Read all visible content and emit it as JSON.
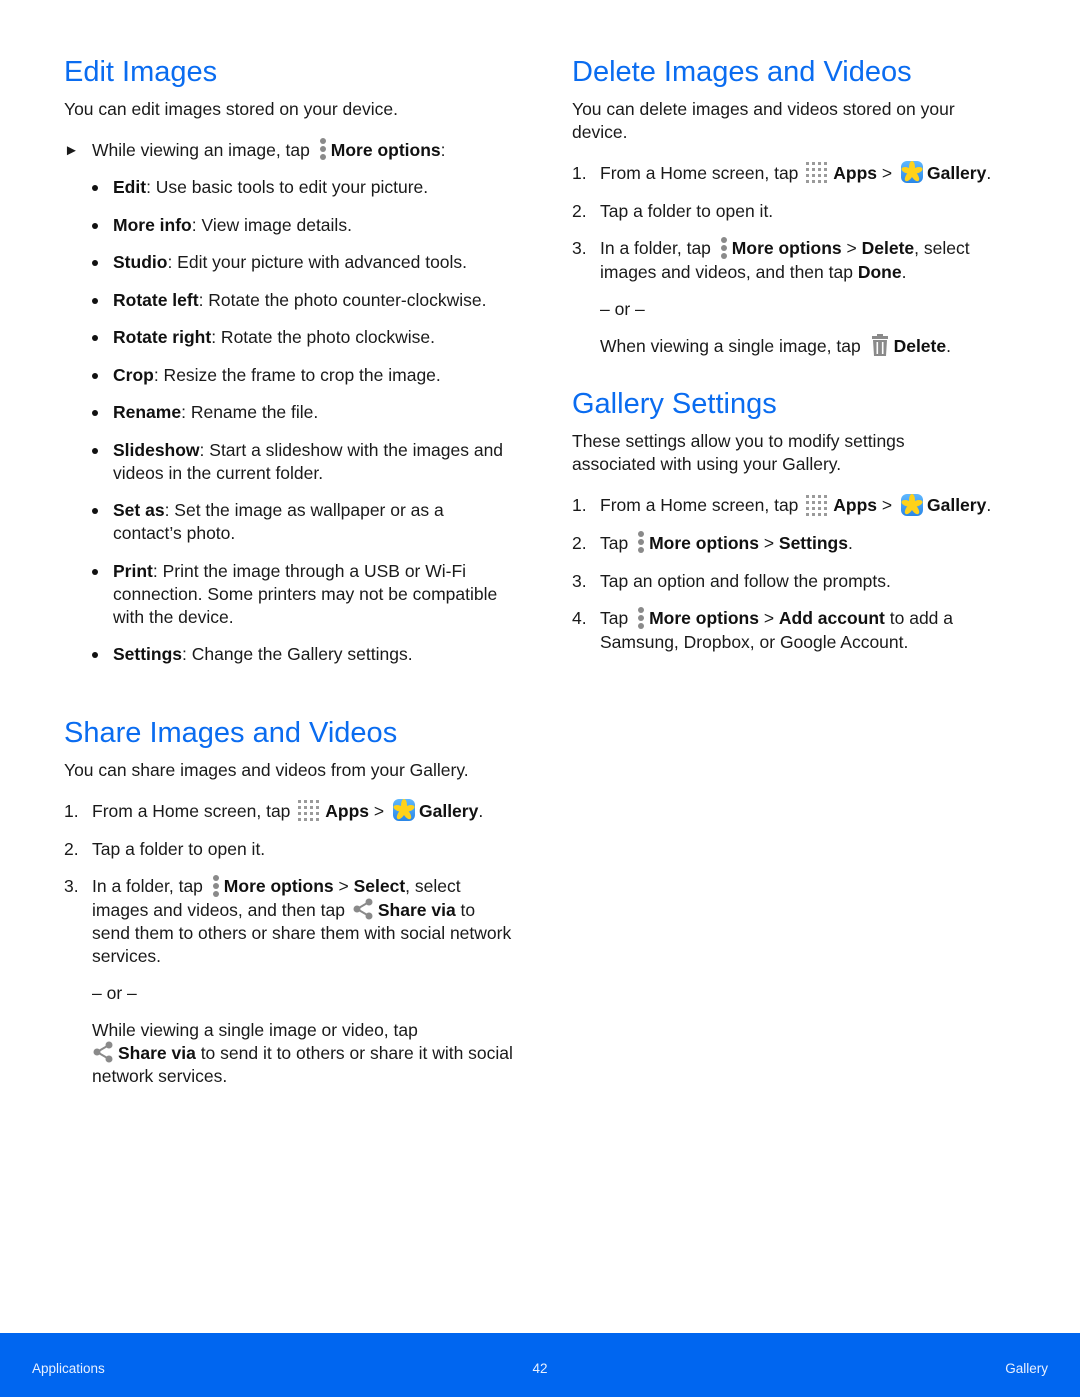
{
  "edit_images": {
    "title": "Edit Images",
    "intro": "You can edit images stored on your device.",
    "instruction": {
      "prefix": "While viewing an image, tap",
      "icon": "more-options-icon",
      "bold": "More options",
      "suffix": ":"
    },
    "options": [
      {
        "bold": "Edit",
        "text": ": Use basic tools to edit your picture."
      },
      {
        "bold": "More info",
        "text": ": View image details."
      },
      {
        "bold": "Studio",
        "text": ": Edit your picture with advanced tools."
      },
      {
        "bold": "Rotate left",
        "text": ": Rotate the photo counter-clockwise."
      },
      {
        "bold": "Rotate right",
        "text": ": Rotate the photo clockwise."
      },
      {
        "bold": "Crop",
        "text": ": Resize the frame to crop the image."
      },
      {
        "bold": "Rename",
        "text": ": Rename the file."
      },
      {
        "bold": "Slideshow",
        "text": ": Start a slideshow with the images and videos in the current folder."
      },
      {
        "bold": "Set as",
        "text": ": Set the image as wallpaper or as a contact’s photo."
      },
      {
        "bold": "Print",
        "text": ": Print the image through a USB or Wi-Fi connection. Some printers may not be compatible with the device."
      },
      {
        "bold": "Settings",
        "text": ": Change the Gallery settings."
      }
    ]
  },
  "share_images": {
    "title": "Share Images and Videos",
    "intro": "You can share images and videos from your Gallery.",
    "step1": {
      "num": "1.",
      "prefix": "From a Home screen, tap",
      "apps": "Apps",
      "sep": " > ",
      "gallery": "Gallery",
      "end": "."
    },
    "step2": {
      "num": "2.",
      "text": "Tap a folder to open it."
    },
    "step3": {
      "num": "3.",
      "prefix": "In a folder, tap",
      "more": "More options",
      "sep": " > ",
      "select": "Select",
      "mid": ", select images and videos, and then tap",
      "share": "Share via",
      "end": " to send them to others or share them with social network services."
    },
    "or": "– or –",
    "alt": {
      "prefix": "While viewing a single image or video, tap",
      "share": "Share via",
      "end": " to send it to others or share it with social network services."
    }
  },
  "delete_images": {
    "title": "Delete Images and Videos",
    "intro": "You can delete images and videos stored on your device.",
    "step1": {
      "num": "1.",
      "prefix": "From a Home screen, tap",
      "apps": "Apps",
      "sep": " > ",
      "gallery": "Gallery",
      "end": "."
    },
    "step2": {
      "num": "2.",
      "text": "Tap a folder to open it."
    },
    "step3": {
      "num": "3.",
      "prefix": "In a folder, tap",
      "more": "More options",
      "sep": " > ",
      "delete": "Delete",
      "mid": ", select images and videos, and then tap",
      "done": "Done",
      "end": "."
    },
    "or": "– or –",
    "alt": {
      "prefix": "When viewing a single image, tap",
      "delete": "Delete",
      "end": "."
    }
  },
  "gallery_settings": {
    "title": "Gallery Settings",
    "intro": "These settings allow you to modify settings associated with using your Gallery.",
    "step1": {
      "num": "1.",
      "prefix": "From a Home screen, tap",
      "apps": "Apps",
      "sep": " > ",
      "gallery": "Gallery",
      "end": "."
    },
    "step2": {
      "num": "2.",
      "prefix": "Tap",
      "more": "More options",
      "sep": " > ",
      "settings": "Settings",
      "end": "."
    },
    "step3": {
      "num": "3.",
      "text": "Tap an option and follow the prompts."
    },
    "step4": {
      "num": "4.",
      "prefix": "Tap",
      "more": "More options",
      "sep": " > ",
      "add": "Add account",
      "end": " to add a Samsung, Dropbox, or Google Account."
    }
  },
  "footer": {
    "left": "Applications",
    "page": "42",
    "right": "Gallery",
    "color": "#0066f0"
  },
  "colors": {
    "heading": "#0a6cf0",
    "icon_gray": "#8a8a8a"
  }
}
